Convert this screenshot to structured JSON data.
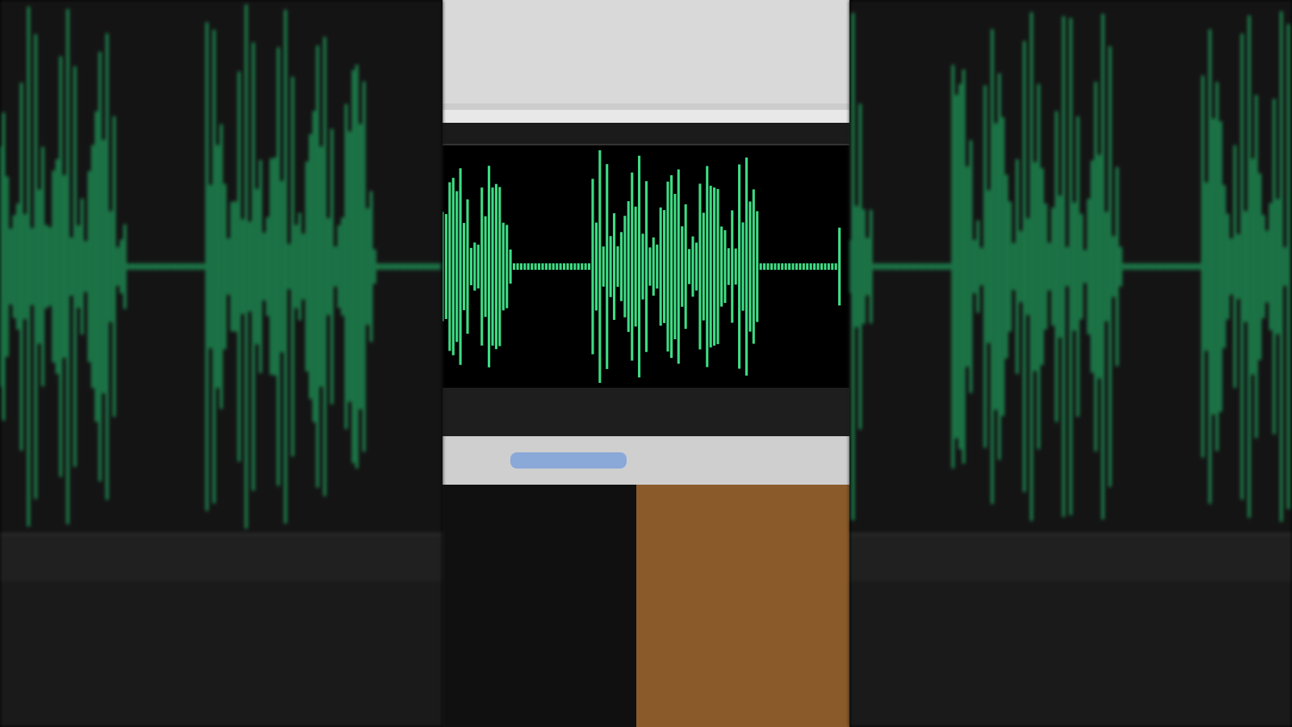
{
  "video_frame": {
    "kind": "photo",
    "blurred_sides": true
  }
}
